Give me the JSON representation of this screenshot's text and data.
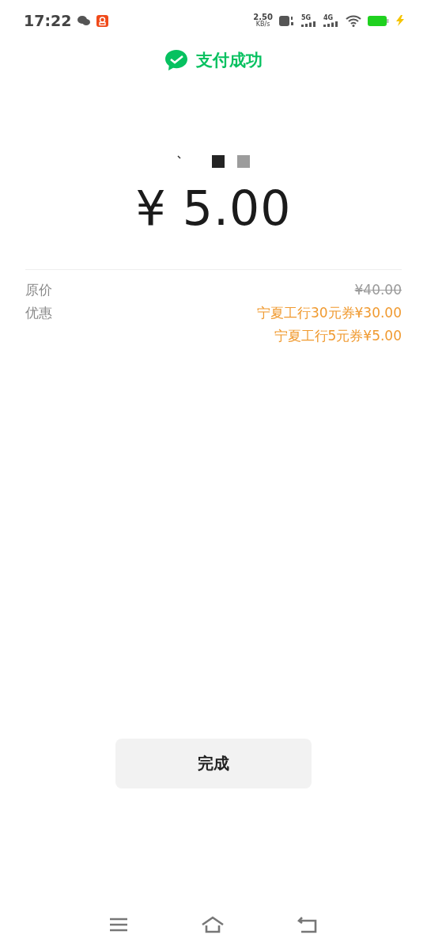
{
  "status_bar": {
    "time": "17:22",
    "speed_value": "2.50",
    "speed_unit": "KB/s",
    "sim_1": "5G",
    "sim_2": "4G"
  },
  "header": {
    "title": "支付成功"
  },
  "payment": {
    "amount": "¥ 5.00"
  },
  "details": [
    {
      "label": "原价",
      "values": [
        "¥40.00"
      ],
      "kind": "original"
    },
    {
      "label": "优惠",
      "values": [
        "宁夏工行30元券¥30.00",
        "宁夏工行5元券¥5.00"
      ],
      "kind": "discount"
    }
  ],
  "done_button": {
    "label": "完成"
  }
}
